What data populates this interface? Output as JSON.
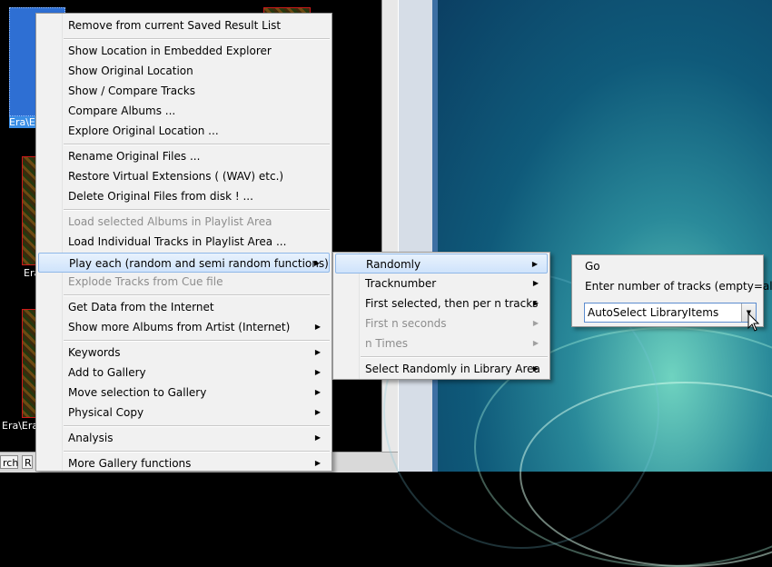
{
  "gallery": {
    "labels": [
      "Era\\Er",
      "Era",
      "Era\\Era"
    ]
  },
  "bottom_bar": {
    "search_button": "rch",
    "r_button": "R"
  },
  "main_menu": {
    "items": [
      {
        "label": "Remove from current Saved Result List",
        "enabled": true,
        "submenu": false
      },
      {
        "label": "Show Location in Embedded Explorer",
        "enabled": true,
        "submenu": false
      },
      {
        "label": "Show Original Location",
        "enabled": true,
        "submenu": false
      },
      {
        "label": "Show / Compare Tracks",
        "enabled": true,
        "submenu": false
      },
      {
        "label": "Compare Albums ...",
        "enabled": true,
        "submenu": false
      },
      {
        "label": "Explore Original Location ...",
        "enabled": true,
        "submenu": false
      },
      {
        "label": "Rename Original Files ...",
        "enabled": true,
        "submenu": false
      },
      {
        "label": "Restore Virtual Extensions ( (WAV) etc.)",
        "enabled": true,
        "submenu": false
      },
      {
        "label": "Delete Original Files from disk ! ...",
        "enabled": true,
        "submenu": false
      },
      {
        "label": "Load selected Albums in Playlist Area",
        "enabled": false,
        "submenu": false
      },
      {
        "label": "Load Individual Tracks in Playlist Area ...",
        "enabled": true,
        "submenu": false
      },
      {
        "label": "Play each (random and semi random functions)",
        "enabled": true,
        "submenu": true,
        "highlighted": true
      },
      {
        "label": "Explode Tracks from Cue file",
        "enabled": false,
        "submenu": false
      },
      {
        "label": "Get Data from the Internet",
        "enabled": true,
        "submenu": false
      },
      {
        "label": "Show more Albums from Artist (Internet)",
        "enabled": true,
        "submenu": true
      },
      {
        "label": "Keywords",
        "enabled": true,
        "submenu": true
      },
      {
        "label": "Add to Gallery",
        "enabled": true,
        "submenu": true
      },
      {
        "label": "Move selection to Gallery",
        "enabled": true,
        "submenu": true
      },
      {
        "label": "Physical Copy",
        "enabled": true,
        "submenu": true
      },
      {
        "label": "Analysis",
        "enabled": true,
        "submenu": true
      },
      {
        "label": "More Gallery functions",
        "enabled": true,
        "submenu": true
      }
    ]
  },
  "play_submenu": {
    "items": [
      {
        "label": "Randomly",
        "enabled": true,
        "highlighted": true
      },
      {
        "label": "Tracknumber",
        "enabled": true
      },
      {
        "label": "First selected, then per n tracks",
        "enabled": true
      },
      {
        "label": "First n seconds",
        "enabled": false
      },
      {
        "label": "n Times",
        "enabled": false
      },
      {
        "label": "Select Randomly in Library Area",
        "enabled": true
      }
    ]
  },
  "random_submenu": {
    "go_label": "Go",
    "count_label": "Enter number of tracks (empty=all)",
    "combo_value": "AutoSelect LibraryItems"
  },
  "icons": {
    "arrow": "submenu-arrow-icon",
    "dropdown": "chevron-down-icon",
    "cursor": "mouse-pointer-icon"
  },
  "colors": {
    "highlight": "#cfe3fb",
    "menu_bg": "#f1f1f1",
    "disabled": "#8d8d8d"
  }
}
